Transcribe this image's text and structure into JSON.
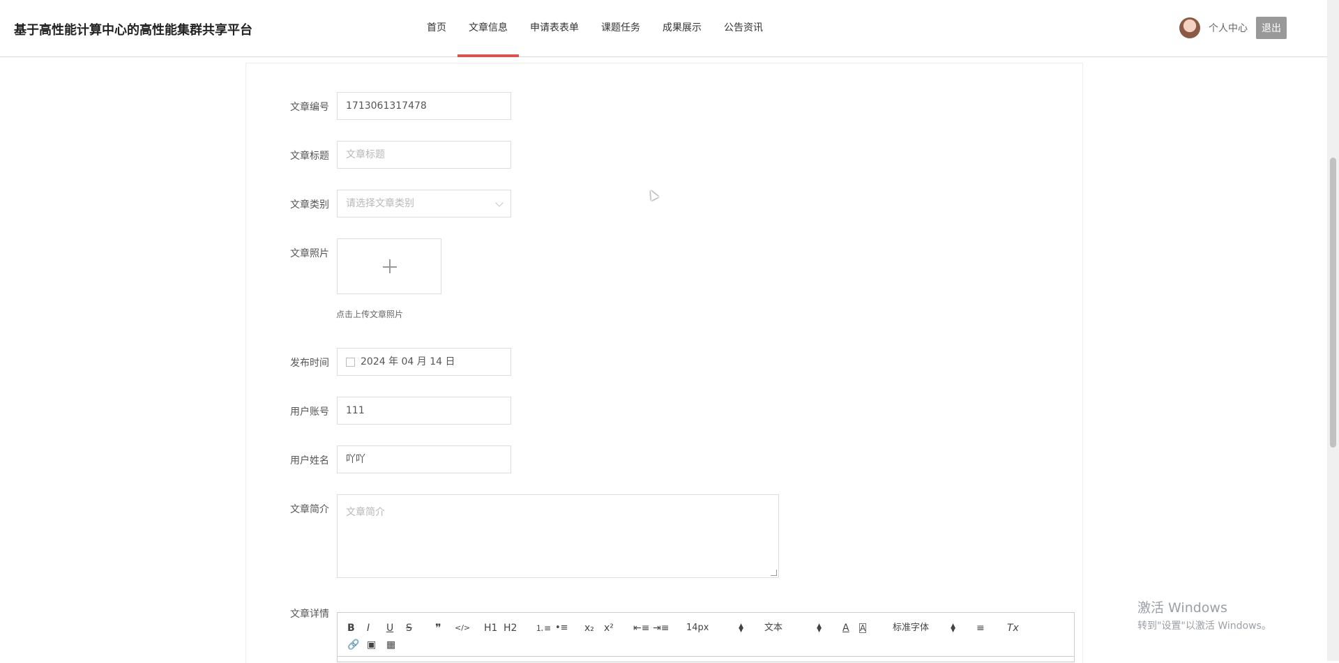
{
  "header": {
    "site_title": "基于高性能计算中心的高性能集群共享平台",
    "nav": [
      "首页",
      "文章信息",
      "申请表表单",
      "课题任务",
      "成果展示",
      "公告资讯"
    ],
    "user_center": "个人中心",
    "logout": "退出"
  },
  "form": {
    "article_no": {
      "label": "文章编号",
      "value": "1713061317478"
    },
    "title": {
      "label": "文章标题",
      "placeholder": "文章标题"
    },
    "category": {
      "label": "文章类别",
      "placeholder": "请选择文章类别"
    },
    "photo": {
      "label": "文章照片",
      "hint": "点击上传文章照片"
    },
    "publish_time": {
      "label": "发布时间",
      "value": "2024 年 04 月 14 日"
    },
    "user_account": {
      "label": "用户账号",
      "value": "111"
    },
    "user_name": {
      "label": "用户姓名",
      "value": "吖吖"
    },
    "summary": {
      "label": "文章简介",
      "placeholder": "文章简介"
    },
    "detail": {
      "label": "文章详情"
    }
  },
  "editor": {
    "bold": "B",
    "italic": "I",
    "underline": "U",
    "strike": "S",
    "quote": "❞",
    "code": "</>",
    "h1": "H1",
    "h2": "H2",
    "subscript": "x₂",
    "superscript": "x²",
    "font_size": "14px",
    "format": "文本",
    "font_family": "标准字体",
    "clear": "Tx"
  },
  "watermark": {
    "line1": "激活 Windows",
    "line2": "转到\"设置\"以激活 Windows。"
  },
  "colors": {
    "accent": "#d9534f"
  }
}
